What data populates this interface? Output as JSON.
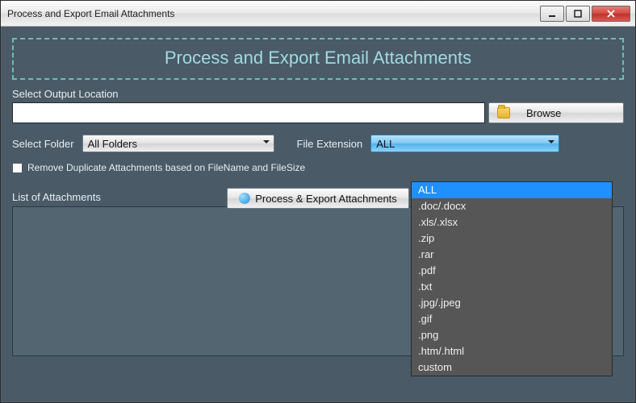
{
  "window": {
    "title": "Process and Export Email Attachments"
  },
  "banner": {
    "heading": "Process and Export Email Attachments"
  },
  "output": {
    "label": "Select Output Location",
    "value": "",
    "browse_label": "Browse"
  },
  "folder": {
    "label": "Select Folder",
    "selected": "All Folders"
  },
  "extension": {
    "label": "File Extension",
    "selected": "ALL",
    "options": [
      "ALL",
      ".doc/.docx",
      ".xls/.xlsx",
      ".zip",
      ".rar",
      ".pdf",
      ".txt",
      ".jpg/.jpeg",
      ".gif",
      ".png",
      ".htm/.html",
      "custom"
    ]
  },
  "dedupe": {
    "label": "Remove Duplicate Attachments based  on FileName and FileSize",
    "checked": false
  },
  "process": {
    "label": "Process & Export Attachments"
  },
  "attachments": {
    "label": "List of Attachments"
  }
}
